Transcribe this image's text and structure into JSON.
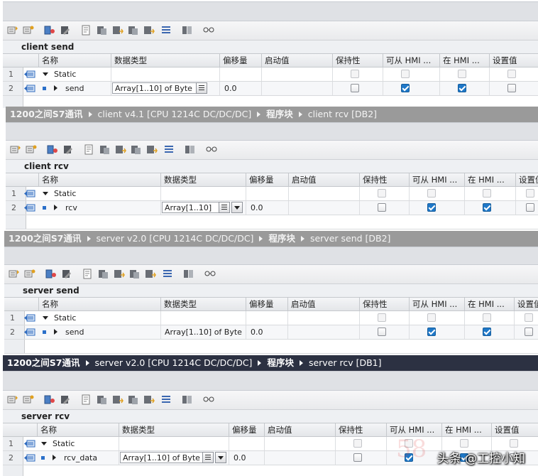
{
  "columns": {
    "name": "名称",
    "type": "数据类型",
    "offset": "偏移量",
    "start": "启动值",
    "retain": "保持性",
    "hmi_access": "可从 HMI ...",
    "hmi_visible": "在 HMI ...",
    "setpoint": "设置值"
  },
  "panels": [
    {
      "title": [],
      "db_name": "client send",
      "rows": [
        {
          "num": "1",
          "name": "Static",
          "type": "",
          "offset": "",
          "retain": false,
          "hmi_access": false,
          "hmi_visible": false,
          "setpoint": false,
          "header": true
        },
        {
          "num": "2",
          "name": "send",
          "type": "Array[1..10] of Byte",
          "offset": "0.0",
          "retain": false,
          "hmi_access": true,
          "hmi_visible": true,
          "setpoint": false,
          "header": false
        }
      ]
    },
    {
      "title": [
        "1200之间S7通讯",
        "client v4.1 [CPU 1214C DC/DC/DC]",
        "程序块",
        "client rcv [DB2]"
      ],
      "db_name": "client rcv",
      "rows": [
        {
          "num": "1",
          "name": "Static",
          "type": "",
          "offset": "",
          "retain": false,
          "hmi_access": false,
          "hmi_visible": false,
          "setpoint": false,
          "header": true
        },
        {
          "num": "2",
          "name": "rcv",
          "type": "Array[1..10] ...",
          "offset": "0.0",
          "retain": false,
          "hmi_access": true,
          "hmi_visible": true,
          "setpoint": false,
          "header": false
        }
      ]
    },
    {
      "title": [
        "1200之间S7通讯",
        "server v2.0 [CPU 1214C DC/DC/DC]",
        "程序块",
        "server send [DB2]"
      ],
      "db_name": "server send",
      "rows": [
        {
          "num": "1",
          "name": "Static",
          "type": "",
          "offset": "",
          "retain": false,
          "hmi_access": false,
          "hmi_visible": false,
          "setpoint": false,
          "header": true
        },
        {
          "num": "2",
          "name": "send",
          "type": "Array[1..10] of Byte",
          "offset": "0.0",
          "retain": false,
          "hmi_access": true,
          "hmi_visible": true,
          "setpoint": false,
          "header": false
        }
      ]
    },
    {
      "title": [
        "1200之间S7通讯",
        "server v2.0 [CPU 1214C DC/DC/DC]",
        "程序块",
        "server rcv [DB1]"
      ],
      "db_name": "server rcv",
      "rows": [
        {
          "num": "1",
          "name": "Static",
          "type": "",
          "offset": "",
          "retain": false,
          "hmi_access": false,
          "hmi_visible": false,
          "setpoint": false,
          "header": true
        },
        {
          "num": "2",
          "name": "rcv_data",
          "type": "Array[1..10] of Byte",
          "offset": "0.0",
          "retain": false,
          "hmi_access": true,
          "hmi_visible": true,
          "setpoint": false,
          "header": false
        }
      ]
    }
  ],
  "watermark": {
    "text": "头条 @工控小知",
    "logo": "58"
  },
  "colors": {
    "title_gray": "#9a9a9a",
    "title_dark": "#2c3142",
    "checkbox_on": "#1f78c8"
  }
}
